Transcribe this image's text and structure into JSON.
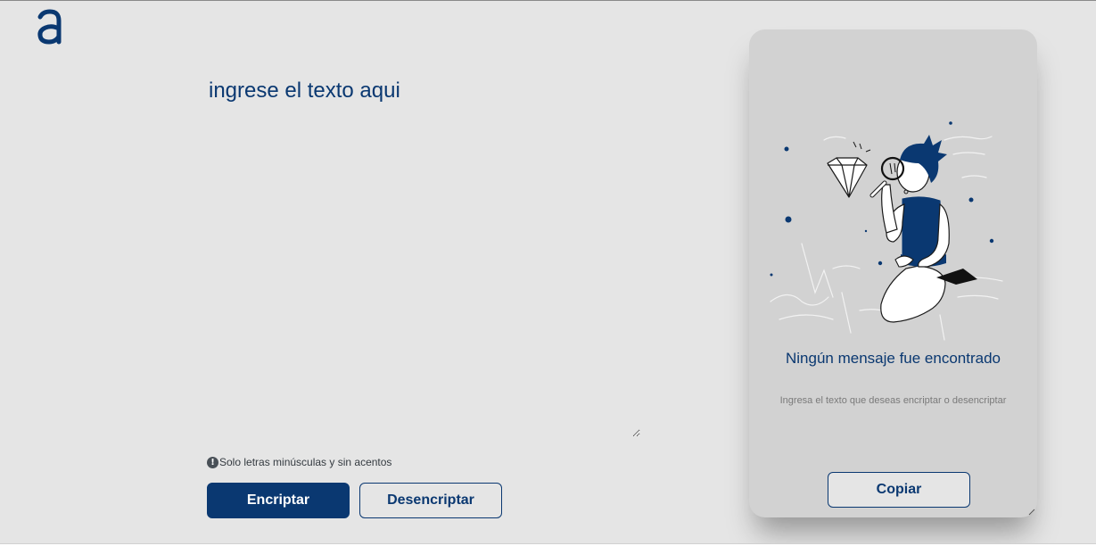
{
  "logo": {
    "icon": "alura-logo-icon",
    "color": "#0a3871"
  },
  "input": {
    "placeholder": "ingrese el texto aqui",
    "value": ""
  },
  "hint": {
    "icon": "info-icon",
    "text": "Solo letras minúsculas y sin acentos"
  },
  "buttons": {
    "encrypt": "Encriptar",
    "decrypt": "Desencriptar"
  },
  "output_panel": {
    "illustration": "person-with-magnifier-diamond-illustration",
    "title": "Ningún mensaje fue encontrado",
    "subtitle": "Ingresa el texto que deseas encriptar o desencriptar",
    "copy_label": "Copiar"
  },
  "colors": {
    "accent": "#0a3871",
    "background": "#e5e5e5",
    "panel": "#d2d2d2"
  }
}
